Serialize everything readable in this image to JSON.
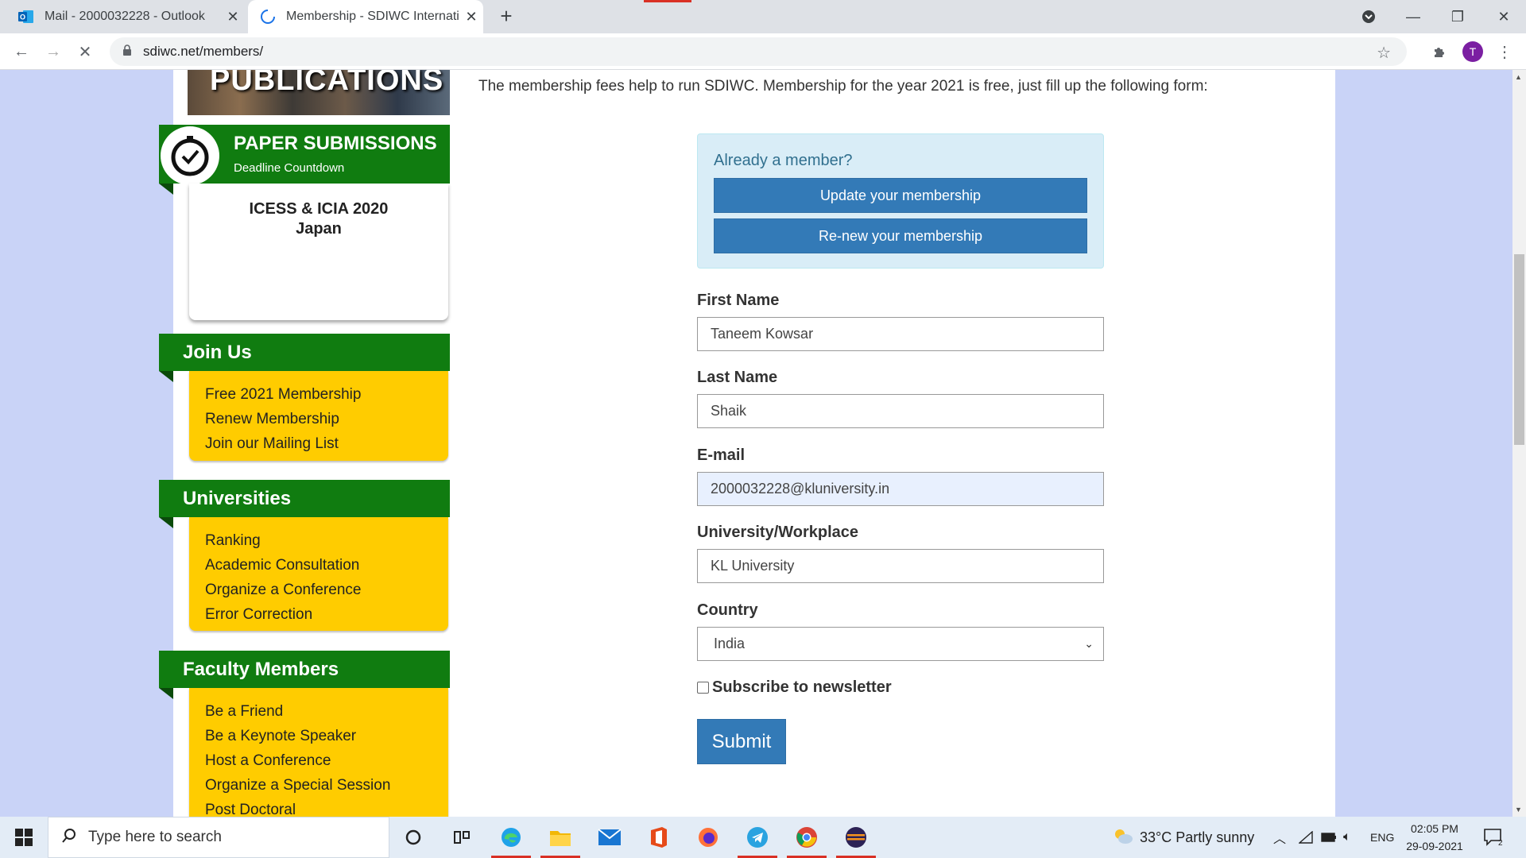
{
  "browser": {
    "tabs": [
      {
        "title": "Mail - 2000032228 - Outlook",
        "icon": "outlook-icon"
      },
      {
        "title": "Membership - SDIWC Internation",
        "icon": "loading-spinner-icon"
      }
    ],
    "new_tab": "+",
    "url": "sdiwc.net/members/",
    "profile_initial": "T"
  },
  "sidebar": {
    "banner_text": "PUBLICATIONS",
    "paper_submissions": {
      "title": "PAPER SUBMISSIONS",
      "subtitle": "Deadline Countdown",
      "conference": "ICESS & ICIA 2020",
      "location": "Japan"
    },
    "join_us": {
      "title": "Join Us",
      "items": [
        "Free 2021 Membership",
        "Renew Membership",
        "Join our Mailing List"
      ]
    },
    "universities": {
      "title": "Universities",
      "items": [
        "Ranking",
        "Academic Consultation",
        "Organize a Conference",
        "Error Correction"
      ]
    },
    "faculty": {
      "title": "Faculty Members",
      "items": [
        "Be a Friend",
        "Be a Keynote Speaker",
        "Host a Conference",
        "Organize a Special Session",
        "Post Doctoral"
      ]
    }
  },
  "main": {
    "intro": "The membership fees help to run SDIWC. Membership for the year 2021 is free, just fill up the following form:",
    "already_member": "Already a member?",
    "update_button": "Update your membership",
    "renew_button": "Re-new your membership",
    "form": {
      "first_name_label": "First Name",
      "first_name_value": "Taneem Kowsar",
      "last_name_label": "Last Name",
      "last_name_value": "Shaik",
      "email_label": "E-mail",
      "email_value": "2000032228@kluniversity.in",
      "university_label": "University/Workplace",
      "university_value": "KL University",
      "country_label": "Country",
      "country_value": "India",
      "newsletter_label": "Subscribe to newsletter",
      "submit_label": "Submit"
    }
  },
  "taskbar": {
    "search_placeholder": "Type here to search",
    "weather": "33°C  Partly sunny",
    "language": "ENG",
    "time": "02:05 PM",
    "date": "29-09-2021",
    "notifications": "2"
  },
  "colors": {
    "green": "#107c10",
    "yellow": "#ffcc00",
    "blue_button": "#337ab7",
    "info_box": "#d9edf7"
  }
}
